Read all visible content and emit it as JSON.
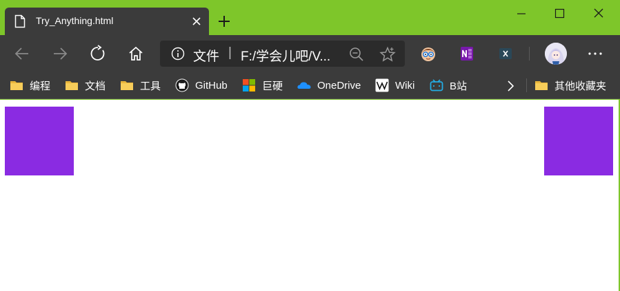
{
  "colors": {
    "frame_accent": "#7ec62a",
    "toolbar_bg": "#3b3b3b",
    "address_bg": "#2b2b2b",
    "content_bg": "#ffffff",
    "box_color": "#8a2be2"
  },
  "tab": {
    "title": "Try_Anything.html",
    "icon": "document-icon"
  },
  "window_controls": [
    "minimize-icon",
    "maximize-icon",
    "close-icon"
  ],
  "toolbar": {
    "back_icon": "arrow-left-icon",
    "forward_icon": "arrow-right-icon",
    "refresh_icon": "refresh-icon",
    "home_icon": "home-icon"
  },
  "address": {
    "scheme_label": "文件",
    "separator": "|",
    "url": "F:/学会儿吧/V..."
  },
  "extensions": [
    "nerd-face-icon",
    "onenote-icon",
    "x-extension-icon"
  ],
  "bookmarks": [
    {
      "label": "编程",
      "icon": "folder-icon"
    },
    {
      "label": "文档",
      "icon": "folder-icon"
    },
    {
      "label": "工具",
      "icon": "folder-icon"
    },
    {
      "label": "GitHub",
      "icon": "github-icon"
    },
    {
      "label": "巨硬",
      "icon": "microsoft-icon"
    },
    {
      "label": "OneDrive",
      "icon": "cloud-icon"
    },
    {
      "label": "Wiki",
      "icon": "wikipedia-icon"
    },
    {
      "label": "B站",
      "icon": "bilibili-icon"
    }
  ],
  "other_bookmarks": {
    "label": "其他收藏夹",
    "icon": "folder-icon"
  }
}
